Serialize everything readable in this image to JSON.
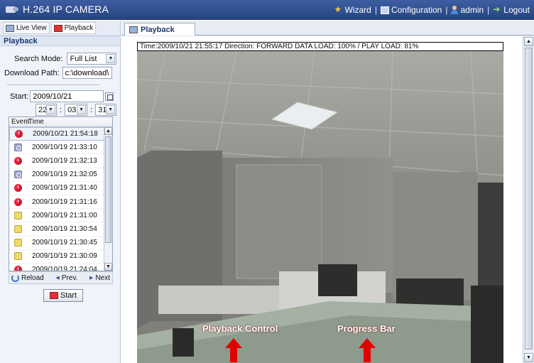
{
  "app": {
    "title": "H.264 IP CAMERA"
  },
  "toplinks": [
    {
      "label": "Wizard",
      "icon": "wizard-icon"
    },
    {
      "label": "Configuration",
      "icon": "config-icon"
    },
    {
      "label": "admin",
      "icon": "user-icon"
    },
    {
      "label": "Logout",
      "icon": "logout-icon"
    }
  ],
  "left_tabs": [
    {
      "label": "Live View"
    },
    {
      "label": "Playback"
    }
  ],
  "panel": {
    "header": "Playback",
    "search_mode_label": "Search Mode:",
    "search_mode_value": "Full List",
    "download_path_label": "Download Path:",
    "download_path_value": "c:\\download\\",
    "start_label": "Start:",
    "start_date": "2009/10/21",
    "hour": "22",
    "minute": "03",
    "second": "31",
    "colon": ":"
  },
  "event_table": {
    "headers": [
      "Event",
      "Time"
    ],
    "rows": [
      {
        "type": "red",
        "time": "2009/10/21 21:54:18"
      },
      {
        "type": "blue",
        "time": "2009/10/19 21:33:10"
      },
      {
        "type": "red",
        "time": "2009/10/19 21:32:13"
      },
      {
        "type": "blue",
        "time": "2009/10/19 21:32:05"
      },
      {
        "type": "red",
        "time": "2009/10/19 21:31:40"
      },
      {
        "type": "red",
        "time": "2009/10/19 21:31:16"
      },
      {
        "type": "yellow",
        "time": "2009/10/19 21:31:00"
      },
      {
        "type": "yellow",
        "time": "2009/10/19 21:30:54"
      },
      {
        "type": "yellow",
        "time": "2009/10/19 21:30:45"
      },
      {
        "type": "yellow",
        "time": "2009/10/19 21:30:09"
      },
      {
        "type": "red",
        "time": "2009/10/19 21:24:04"
      }
    ]
  },
  "nav": {
    "reload": "Reload",
    "prev": "Prev.",
    "next": "Next"
  },
  "start_button": "Start",
  "right_tab": "Playback",
  "info_bar": "Time:2009/10/21 21:55:17   Direction: FORWARD  DATA LOAD: 100% / PLAY LOAD: 81%",
  "annotations": {
    "playback_control": "Playback Control",
    "progress_bar": "Progress Bar"
  },
  "progress": {
    "fraction": 0.78
  },
  "colors": {
    "topbar": "#2f4f8f",
    "annotation_red": "#e10000"
  }
}
